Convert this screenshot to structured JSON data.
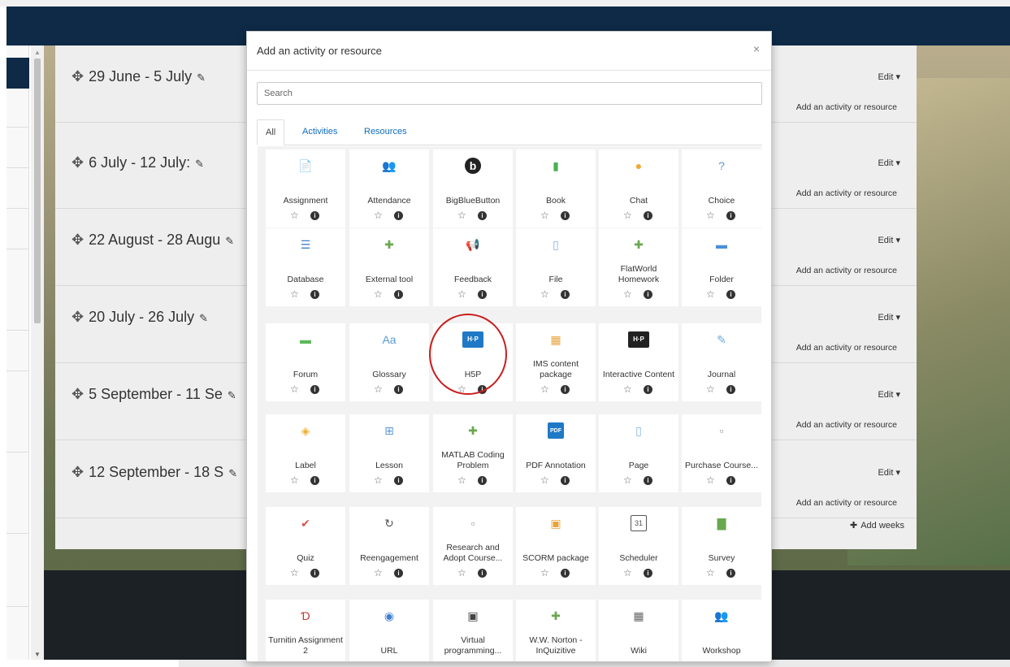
{
  "background": {
    "weeks": [
      {
        "title": "29 June - 5 July",
        "edit": "Edit ▾",
        "add_activity": "Add an activity or resource"
      },
      {
        "title": "6 July - 12 July:",
        "edit": "Edit ▾",
        "add_activity": "Add an activity or resource"
      },
      {
        "title": "22 August - 28 Augu",
        "edit": "Edit ▾",
        "add_activity": "Add an activity or resource"
      },
      {
        "title": "20 July - 26 July",
        "edit": "Edit ▾",
        "add_activity": "Add an activity or resource"
      },
      {
        "title": "5 September - 11 Se",
        "edit": "Edit ▾",
        "add_activity": "Add an activity or resource"
      },
      {
        "title": "12 September - 18 S",
        "edit": "Edit ▾",
        "add_activity": "Add an activity or resource"
      }
    ],
    "add_weeks": "Add weeks"
  },
  "modal": {
    "title": "Add an activity or resource",
    "close": "×",
    "search_placeholder": "Search",
    "tabs": [
      "All",
      "Activities",
      "Resources"
    ],
    "items": [
      {
        "label": "Assignment",
        "icon": "assignment-icon",
        "glyph": "📄",
        "color": "#5b9bd5"
      },
      {
        "label": "Attendance",
        "icon": "attendance-icon",
        "glyph": "👥",
        "color": "#6aa84f"
      },
      {
        "label": "BigBlueButton",
        "icon": "bigbluebutton-icon",
        "glyph": "b",
        "color": "#222222"
      },
      {
        "label": "Book",
        "icon": "book-icon",
        "glyph": "▮",
        "color": "#4caf50"
      },
      {
        "label": "Chat",
        "icon": "chat-icon",
        "glyph": "●",
        "color": "#f0a830"
      },
      {
        "label": "Choice",
        "icon": "choice-icon",
        "glyph": "?",
        "color": "#5b9bd5"
      },
      {
        "label": "Database",
        "icon": "database-icon",
        "glyph": "☰",
        "color": "#3f7fd0"
      },
      {
        "label": "External tool",
        "icon": "external-tool-icon",
        "glyph": "✚",
        "color": "#6aa84f"
      },
      {
        "label": "Feedback",
        "icon": "feedback-icon",
        "glyph": "📢",
        "color": "#d9534f"
      },
      {
        "label": "File",
        "icon": "file-icon",
        "glyph": "▯",
        "color": "#7fb2e5"
      },
      {
        "label": "FlatWorld Homework",
        "icon": "flatworld-homework-icon",
        "glyph": "✚",
        "color": "#6aa84f"
      },
      {
        "label": "Folder",
        "icon": "folder-icon",
        "glyph": "▬",
        "color": "#4a90d9"
      },
      {
        "label": "Forum",
        "icon": "forum-icon",
        "glyph": "▬",
        "color": "#5cb85c"
      },
      {
        "label": "Glossary",
        "icon": "glossary-icon",
        "glyph": "Aa",
        "color": "#5b9bd5"
      },
      {
        "label": "H5P",
        "icon": "h5p-icon",
        "glyph": "H·P",
        "color": "#1f79c6"
      },
      {
        "label": "IMS content package",
        "icon": "ims-content-package-icon",
        "glyph": "▦",
        "color": "#e8a33a"
      },
      {
        "label": "Interactive Content",
        "icon": "interactive-content-icon",
        "glyph": "H·P",
        "color": "#222222"
      },
      {
        "label": "Journal",
        "icon": "journal-icon",
        "glyph": "✎",
        "color": "#6fa8dc"
      },
      {
        "label": "Label",
        "icon": "label-icon",
        "glyph": "◈",
        "color": "#f0b030"
      },
      {
        "label": "Lesson",
        "icon": "lesson-icon",
        "glyph": "⊞",
        "color": "#5b9bd5"
      },
      {
        "label": "MATLAB Coding Problem",
        "icon": "matlab-coding-problem-icon",
        "glyph": "✚",
        "color": "#6aa84f"
      },
      {
        "label": "PDF Annotation",
        "icon": "pdf-annotation-icon",
        "glyph": "PDF",
        "color": "#1f79c6"
      },
      {
        "label": "Page",
        "icon": "page-icon",
        "glyph": "▯",
        "color": "#7fb2e5"
      },
      {
        "label": "Purchase Course...",
        "icon": "broken-image-icon",
        "glyph": "▫",
        "color": "#999999"
      },
      {
        "label": "Quiz",
        "icon": "quiz-icon",
        "glyph": "✔",
        "color": "#d9534f"
      },
      {
        "label": "Reengagement",
        "icon": "reengagement-icon",
        "glyph": "↻",
        "color": "#555555"
      },
      {
        "label": "Research and Adopt Course...",
        "icon": "broken-image-icon",
        "glyph": "▫",
        "color": "#999999"
      },
      {
        "label": "SCORM package",
        "icon": "scorm-package-icon",
        "glyph": "▣",
        "color": "#e8a33a"
      },
      {
        "label": "Scheduler",
        "icon": "scheduler-icon",
        "glyph": "31",
        "color": "#555555"
      },
      {
        "label": "Survey",
        "icon": "survey-icon",
        "glyph": "▇",
        "color": "#6aa84f"
      },
      {
        "label": "Turnitin Assignment 2",
        "icon": "turnitin-icon",
        "glyph": "Ɗ",
        "color": "#c0392b"
      },
      {
        "label": "URL",
        "icon": "url-icon",
        "glyph": "◉",
        "color": "#3f7fd0"
      },
      {
        "label": "Virtual programming...",
        "icon": "virtual-programming-icon",
        "glyph": "▣",
        "color": "#444444"
      },
      {
        "label": "W.W. Norton - InQuizitive",
        "icon": "ww-norton-icon",
        "glyph": "✚",
        "color": "#6aa84f"
      },
      {
        "label": "Wiki",
        "icon": "wiki-icon",
        "glyph": "▦",
        "color": "#666666"
      },
      {
        "label": "Workshop",
        "icon": "workshop-icon",
        "glyph": "👥",
        "color": "#e8a33a"
      }
    ],
    "fav_glyph": "☆",
    "info_glyph": "i"
  }
}
